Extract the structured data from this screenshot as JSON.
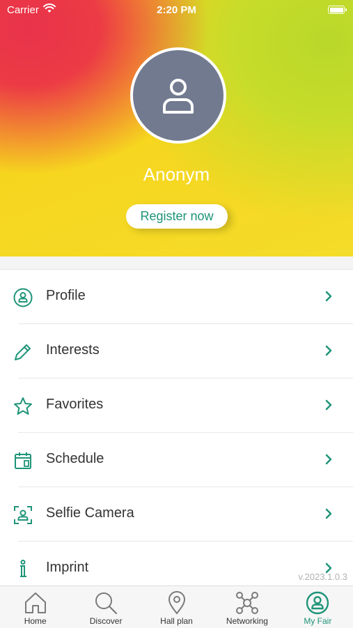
{
  "status_bar": {
    "carrier": "Carrier",
    "time": "2:20 PM"
  },
  "profile": {
    "name": "Anonym",
    "register_label": "Register now"
  },
  "menu": [
    {
      "label": "Profile",
      "icon": "person-circle-icon"
    },
    {
      "label": "Interests",
      "icon": "pencil-icon"
    },
    {
      "label": "Favorites",
      "icon": "star-icon"
    },
    {
      "label": "Schedule",
      "icon": "calendar-icon"
    },
    {
      "label": "Selfie Camera",
      "icon": "selfie-camera-icon"
    },
    {
      "label": "Imprint",
      "icon": "info-icon"
    }
  ],
  "version": "v.2023.1.0.3",
  "tabbar": [
    {
      "label": "Home",
      "icon": "home-icon"
    },
    {
      "label": "Discover",
      "icon": "search-icon"
    },
    {
      "label": "Hall plan",
      "icon": "map-pin-icon"
    },
    {
      "label": "Networking",
      "icon": "network-icon"
    },
    {
      "label": "My Fair",
      "icon": "person-circle-icon"
    }
  ],
  "colors": {
    "accent": "#1e9478",
    "avatar_bg": "#727a90"
  }
}
